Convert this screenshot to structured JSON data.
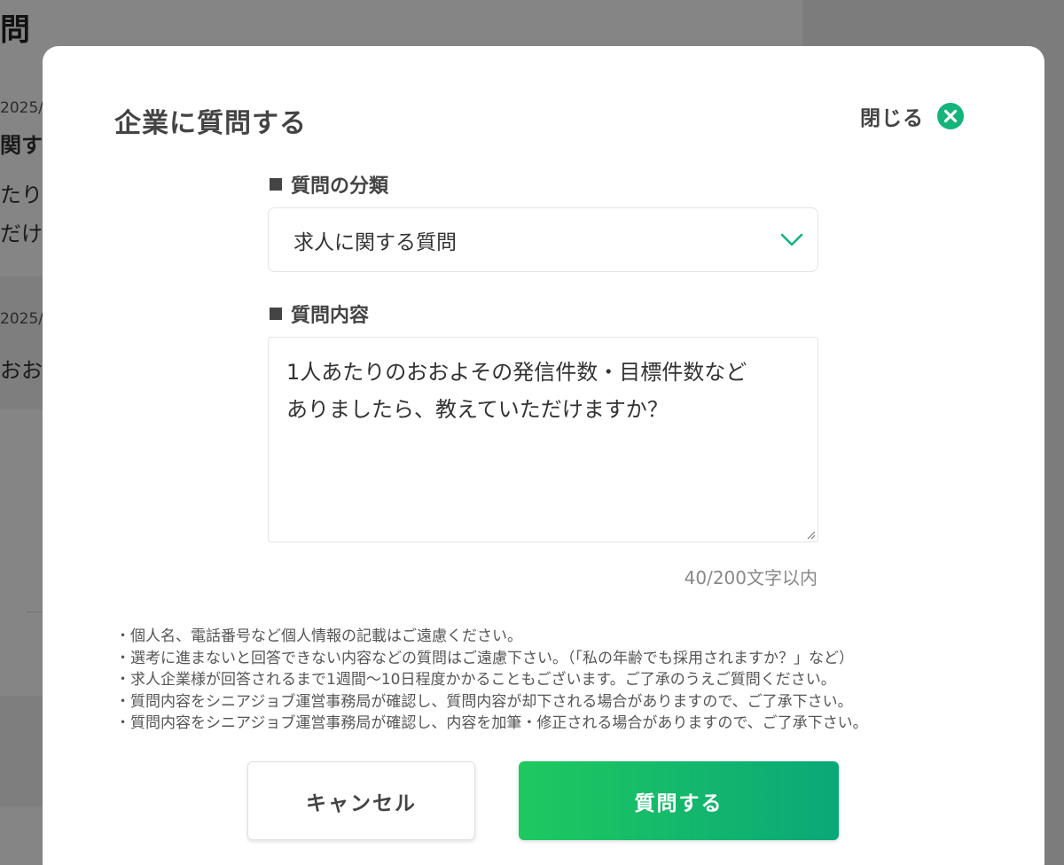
{
  "background": {
    "title_fragment": "問",
    "items": [
      {
        "date": "2025/",
        "line1": "関す",
        "line2": "たり",
        "line3": "だけま"
      },
      {
        "date": "2025/",
        "line1": "おお"
      }
    ]
  },
  "modal": {
    "title": "企業に質問する",
    "close_label": "閉じる",
    "category": {
      "label": "質問の分類",
      "selected_value": "求人に関する質問"
    },
    "content": {
      "label": "質問内容",
      "value": "1人あたりのおおよその発信件数・目標件数など\nありましたら、教えていただけますか？",
      "counter": "40/200文字以内"
    },
    "notes": [
      "・個人名、電話番号など個人情報の記載はご遠慮ください。",
      "・選考に進まないと回答できない内容などの質問はご遠慮下さい。（「私の年齢でも採用されますか？」など）",
      "・求人企業様が回答されるまで1週間〜10日程度かかることもございます。ご了承のうえご質問ください。",
      "・質問内容をシニアジョブ運営事務局が確認し、質問内容が却下される場合がありますので、ご了承下さい。",
      "・質問内容をシニアジョブ運営事務局が確認し、内容を加筆・修正される場合がありますので、ご了承下さい。"
    ],
    "buttons": {
      "cancel": "キャンセル",
      "submit": "質問する"
    }
  },
  "colors": {
    "accent": "#13b57a",
    "gradient_start": "#1ec95f",
    "gradient_end": "#0aa878",
    "overlay": "rgba(0,0,0,0.48)"
  }
}
